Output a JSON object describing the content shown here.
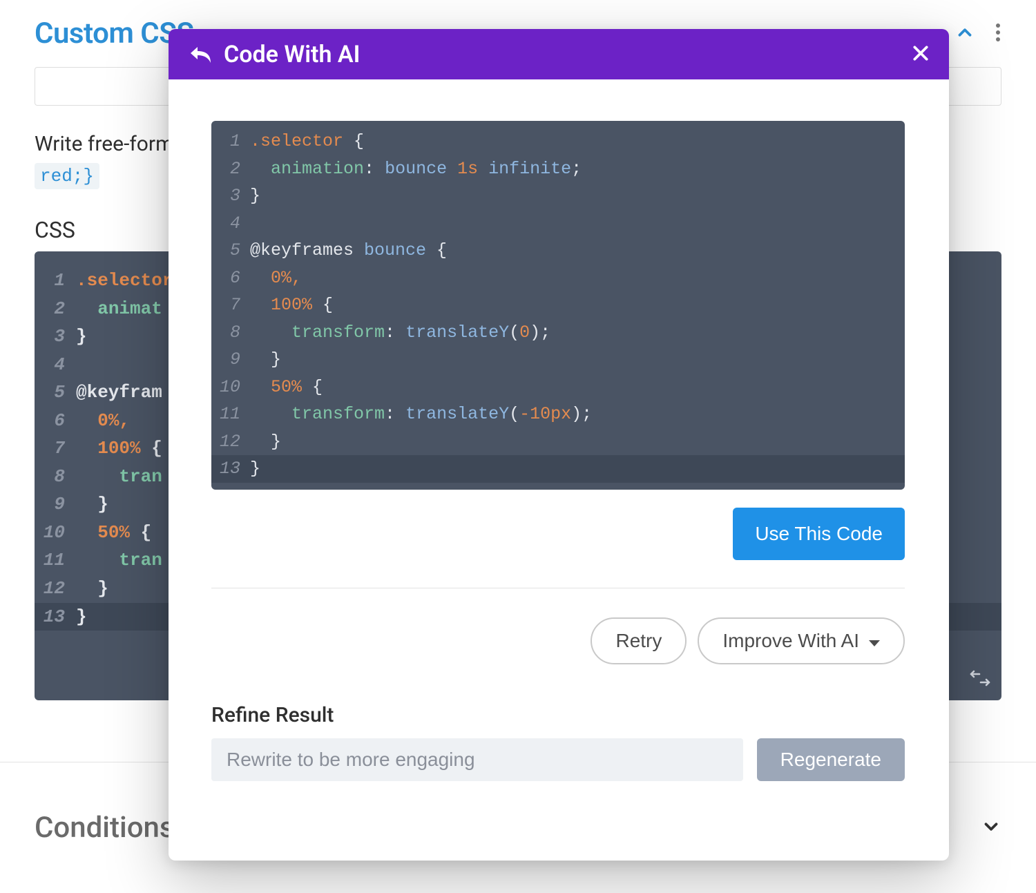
{
  "background": {
    "section_title": "Custom CSS",
    "description": "Write free-form",
    "example_chip": "red;}",
    "css_label": "CSS",
    "conditions_label": "Conditions",
    "code": [
      [
        {
          "t": "selector",
          "v": ".selector"
        },
        {
          "t": "plain",
          "v": " "
        }
      ],
      [
        {
          "t": "pad",
          "v": "  "
        },
        {
          "t": "prop",
          "v": "animat"
        }
      ],
      [
        {
          "t": "punc",
          "v": "}"
        }
      ],
      [],
      [
        {
          "t": "keyword",
          "v": "@keyfram"
        }
      ],
      [
        {
          "t": "pad",
          "v": "  "
        },
        {
          "t": "valnum",
          "v": "0%"
        },
        {
          "t": "comma",
          "v": ","
        }
      ],
      [
        {
          "t": "pad",
          "v": "  "
        },
        {
          "t": "valnum",
          "v": "100%"
        },
        {
          "t": "punc",
          "v": " {"
        }
      ],
      [
        {
          "t": "pad",
          "v": "    "
        },
        {
          "t": "prop",
          "v": "tran"
        }
      ],
      [
        {
          "t": "pad",
          "v": "  "
        },
        {
          "t": "punc",
          "v": "}"
        }
      ],
      [
        {
          "t": "pad",
          "v": "  "
        },
        {
          "t": "valnum",
          "v": "50%"
        },
        {
          "t": "punc",
          "v": " {"
        }
      ],
      [
        {
          "t": "pad",
          "v": "    "
        },
        {
          "t": "prop",
          "v": "tran"
        }
      ],
      [
        {
          "t": "pad",
          "v": "  "
        },
        {
          "t": "punc",
          "v": "}"
        }
      ],
      [
        {
          "t": "punc",
          "v": "}"
        }
      ]
    ]
  },
  "modal": {
    "title": "Code With AI",
    "use_code_label": "Use This Code",
    "retry_label": "Retry",
    "improve_label": "Improve With AI",
    "refine_label": "Refine Result",
    "refine_placeholder": "Rewrite to be more engaging",
    "regenerate_label": "Regenerate",
    "code": [
      [
        {
          "t": "selector",
          "v": ".selector"
        },
        {
          "t": "punc",
          "v": " {"
        }
      ],
      [
        {
          "t": "pad",
          "v": "  "
        },
        {
          "t": "prop",
          "v": "animation"
        },
        {
          "t": "punc",
          "v": ": "
        },
        {
          "t": "value",
          "v": "bounce"
        },
        {
          "t": "punc",
          "v": " "
        },
        {
          "t": "valnum",
          "v": "1s"
        },
        {
          "t": "punc",
          "v": " "
        },
        {
          "t": "value",
          "v": "infinite"
        },
        {
          "t": "punc",
          "v": ";"
        }
      ],
      [
        {
          "t": "punc",
          "v": "}"
        }
      ],
      [],
      [
        {
          "t": "keyword",
          "v": "@keyframes "
        },
        {
          "t": "value",
          "v": "bounce"
        },
        {
          "t": "punc",
          "v": " {"
        }
      ],
      [
        {
          "t": "pad",
          "v": "  "
        },
        {
          "t": "valnum",
          "v": "0%"
        },
        {
          "t": "comma",
          "v": ","
        }
      ],
      [
        {
          "t": "pad",
          "v": "  "
        },
        {
          "t": "valnum",
          "v": "100%"
        },
        {
          "t": "punc",
          "v": " {"
        }
      ],
      [
        {
          "t": "pad",
          "v": "    "
        },
        {
          "t": "prop",
          "v": "transform"
        },
        {
          "t": "punc",
          "v": ": "
        },
        {
          "t": "func",
          "v": "translateY"
        },
        {
          "t": "punc",
          "v": "("
        },
        {
          "t": "valnum",
          "v": "0"
        },
        {
          "t": "punc",
          "v": ");"
        }
      ],
      [
        {
          "t": "pad",
          "v": "  "
        },
        {
          "t": "punc",
          "v": "}"
        }
      ],
      [
        {
          "t": "pad",
          "v": "  "
        },
        {
          "t": "valnum",
          "v": "50%"
        },
        {
          "t": "punc",
          "v": " {"
        }
      ],
      [
        {
          "t": "pad",
          "v": "    "
        },
        {
          "t": "prop",
          "v": "transform"
        },
        {
          "t": "punc",
          "v": ": "
        },
        {
          "t": "func",
          "v": "translateY"
        },
        {
          "t": "punc",
          "v": "("
        },
        {
          "t": "valnum",
          "v": "-10px"
        },
        {
          "t": "punc",
          "v": ");"
        }
      ],
      [
        {
          "t": "pad",
          "v": "  "
        },
        {
          "t": "punc",
          "v": "}"
        }
      ],
      [
        {
          "t": "punc",
          "v": "}"
        }
      ]
    ],
    "highlight_line": 13
  }
}
